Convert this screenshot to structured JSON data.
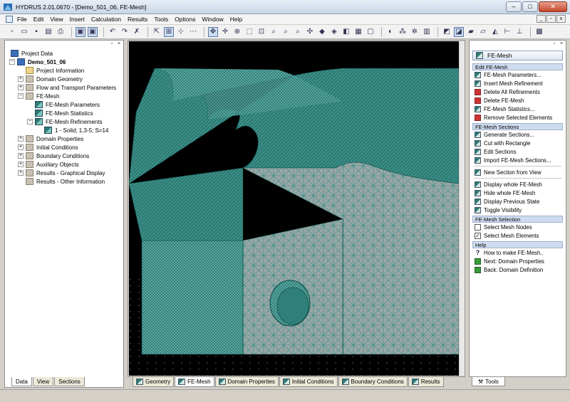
{
  "window": {
    "title": "HYDRUS 2.01.0670 - [Demo_501_06, FE-Mesh]",
    "controls": [
      "–",
      "□",
      "✕"
    ]
  },
  "menu": [
    "File",
    "Edit",
    "View",
    "Insert",
    "Calculation",
    "Results",
    "Tools",
    "Options",
    "Window",
    "Help"
  ],
  "mdi_controls": [
    "_",
    "▫",
    "x"
  ],
  "toolbar_icons": [
    "new-file-icon",
    "open-folder-icon",
    "save-icon",
    "print-preview-icon",
    "print-icon",
    "view-mode-1-icon",
    "view-mode-2-icon",
    "undo-icon",
    "redo-icon",
    "delete-icon",
    "select-icon",
    "grid-icon",
    "snap-icon",
    "rotate-icon",
    "zoom-icon",
    "zoom-in-icon",
    "zoom-out-icon",
    "zoom-fit-icon",
    "view-3d-icon",
    "render-icon",
    "section-icon",
    "mesh-icon",
    "results-icon"
  ],
  "tree": {
    "root_label": "Project Data",
    "project": "Demo_501_06",
    "items": [
      {
        "label": "Project Information",
        "level": 2,
        "expander": ""
      },
      {
        "label": "Domain Geometry",
        "level": 2,
        "expander": "+"
      },
      {
        "label": "Flow and Transport Parameters",
        "level": 2,
        "expander": "+"
      },
      {
        "label": "FE-Mesh",
        "level": 2,
        "expander": "−"
      },
      {
        "label": "FE-Mesh Parameters",
        "level": 3,
        "expander": ""
      },
      {
        "label": "FE-Mesh Statistics",
        "level": 3,
        "expander": ""
      },
      {
        "label": "FE-Mesh Refinements",
        "level": 3,
        "expander": "−"
      },
      {
        "label": "1 - Solid; 1,3-5; S=14",
        "level": 4,
        "expander": ""
      },
      {
        "label": "Domain Properties",
        "level": 2,
        "expander": "+"
      },
      {
        "label": "Initial Conditions",
        "level": 2,
        "expander": "+"
      },
      {
        "label": "Boundary Conditions",
        "level": 2,
        "expander": "+"
      },
      {
        "label": "Auxiliary Objects",
        "level": 2,
        "expander": "+"
      },
      {
        "label": "Results - Graphical Display",
        "level": 2,
        "expander": "+"
      },
      {
        "label": "Results - Other Information",
        "level": 2,
        "expander": ""
      }
    ]
  },
  "left_tabs": [
    "Data",
    "View",
    "Sections"
  ],
  "bottom_tabs": [
    "Geometry",
    "FE-Mesh",
    "Domain Properties",
    "Initial Conditions",
    "Boundary Conditions",
    "Results"
  ],
  "right_panel": {
    "header": "FE-Mesh",
    "sections": [
      {
        "title": "Edit FE-Mesh",
        "items": [
          "FE-Mesh Parameters...",
          "Insert Mesh Refinement",
          "Delete All Refinements",
          "Delete FE-Mesh",
          "FE-Mesh Statistics...",
          "Remove Selected Elements"
        ]
      },
      {
        "title": "FE-Mesh Sections",
        "items": [
          "Generate Sections...",
          "Cut with Rectangle",
          "Edit Sections",
          "Import FE-Mesh Sections...",
          "|",
          "New Section from View",
          "|",
          "Display whole FE-Mesh",
          "Hide whole FE-Mesh",
          "Display Previous State",
          "Toggle Visibility"
        ]
      },
      {
        "title": "FE-Mesh Selection",
        "items": [
          "Select Mesh Nodes",
          "Select Mesh Elements"
        ]
      },
      {
        "title": "Help",
        "items": [
          "How to make FE-Mesh..",
          "Next: Domain Properties",
          "Back: Domain Definition"
        ]
      }
    ]
  },
  "right_tabs": [
    "Tools"
  ],
  "colors": {
    "mesh_teal": "#2f7f7a",
    "mesh_light": "#8fd0c8",
    "mesh_grey": "#9aa7a6"
  }
}
